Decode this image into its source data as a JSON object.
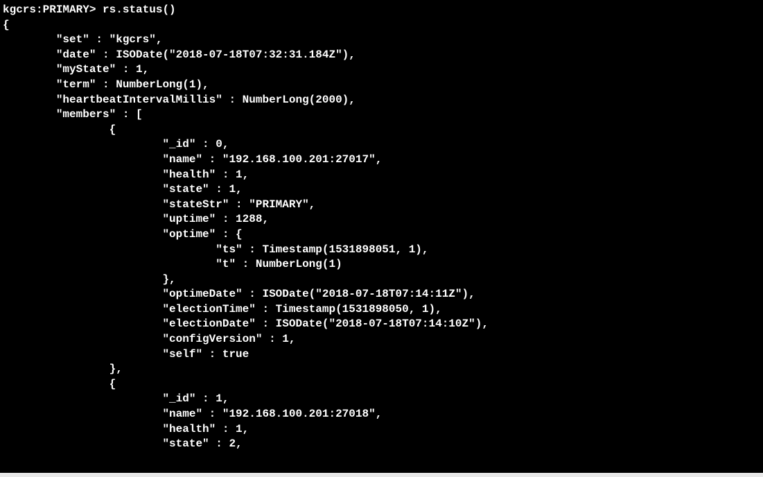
{
  "prompt": "kgcrs:PRIMARY> ",
  "command": "rs.status()",
  "output": {
    "open_brace": "{",
    "set_line": "        \"set\" : \"kgcrs\",",
    "date_line": "        \"date\" : ISODate(\"2018-07-18T07:32:31.184Z\"),",
    "mystate_line": "        \"myState\" : 1,",
    "term_line": "        \"term\" : NumberLong(1),",
    "heartbeat_line": "        \"heartbeatIntervalMillis\" : NumberLong(2000),",
    "members_line": "        \"members\" : [",
    "m0_open": "                {",
    "m0_id": "                        \"_id\" : 0,",
    "m0_name": "                        \"name\" : \"192.168.100.201:27017\",",
    "m0_health": "                        \"health\" : 1,",
    "m0_state": "                        \"state\" : 1,",
    "m0_statestr": "                        \"stateStr\" : \"PRIMARY\",",
    "m0_uptime": "                        \"uptime\" : 1288,",
    "m0_optime_open": "                        \"optime\" : {",
    "m0_optime_ts": "                                \"ts\" : Timestamp(1531898051, 1),",
    "m0_optime_t": "                                \"t\" : NumberLong(1)",
    "m0_optime_close": "                        },",
    "m0_optimedate": "                        \"optimeDate\" : ISODate(\"2018-07-18T07:14:11Z\"),",
    "m0_electiontime": "                        \"electionTime\" : Timestamp(1531898050, 1),",
    "m0_electiondate": "                        \"electionDate\" : ISODate(\"2018-07-18T07:14:10Z\"),",
    "m0_configversion": "                        \"configVersion\" : 1,",
    "m0_self": "                        \"self\" : true",
    "m0_close": "                },",
    "m1_open": "                {",
    "m1_id": "                        \"_id\" : 1,",
    "m1_name": "                        \"name\" : \"192.168.100.201:27018\",",
    "m1_health": "                        \"health\" : 1,",
    "m1_state": "                        \"state\" : 2,"
  }
}
